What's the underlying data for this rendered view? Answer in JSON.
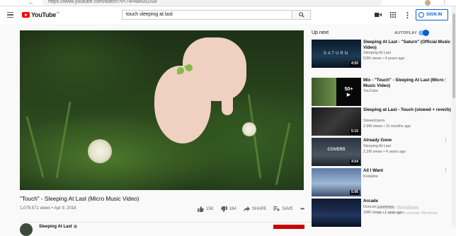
{
  "browser": {
    "url": "https://www.youtube.com/watch?v=74PAwSIGIS8",
    "back_icon": "back-arrow-icon"
  },
  "masthead": {
    "logo_text": "YouTube",
    "region_mark": "IN",
    "search_value": "touch sleeping at last",
    "signin_label": "SIGN IN",
    "icons": [
      "menu-icon",
      "search-icon",
      "video-camera-icon",
      "apps-grid-icon",
      "more-vert-icon",
      "account-icon"
    ]
  },
  "video": {
    "title": "\"Touch\" - Sleeping At Last (Micro Music Video)",
    "meta": "1,079,571 views • Apr 9, 2018",
    "likes": "15K",
    "dislikes": "184",
    "share_label": "SHARE",
    "save_label": "SAVE",
    "channel_name": "Sleeping At Last"
  },
  "sidebar": {
    "upnext_label": "Up next",
    "autoplay_label": "AUTOPLAY",
    "autoplay_on": true,
    "items": [
      {
        "title": "Sleeping At Last - \"Saturn\" (Official Music Video)",
        "channel": "Sleeping At Last",
        "stats": "52M views • 4 years ago",
        "duration": "4:50",
        "thumb_text": "SATURN"
      },
      {
        "title": "Mix - \"Touch\" - Sleeping At Last (Micro Music Video)",
        "channel": "YouTube",
        "stats": "",
        "duration": "",
        "thumb_text": "50+"
      },
      {
        "title": "Sleeping at Last - Touch (slowed + reverb)",
        "channel": "SlowedJams",
        "stats": "2.9M views • 11 months ago",
        "duration": "5:10",
        "thumb_text": ""
      },
      {
        "title": "Already Gone",
        "channel": "Sleeping At Last",
        "stats": "2.2M views • 4 years ago",
        "duration": "4:04",
        "thumb_text": "COVERS"
      },
      {
        "title": "All I Want",
        "channel": "Kodaline",
        "stats": "",
        "duration": "5:06",
        "thumb_text": ""
      },
      {
        "title": "Arcade",
        "channel": "Duncan Laurence",
        "stats": "16M views • 1 year ago",
        "duration": "",
        "thumb_text": ""
      }
    ]
  },
  "overlay": {
    "line1": "Activate Windows",
    "line2": "Go to Settings to activate Windows."
  },
  "colors": {
    "brand_red": "#ff0000",
    "link_blue": "#065fd4"
  }
}
